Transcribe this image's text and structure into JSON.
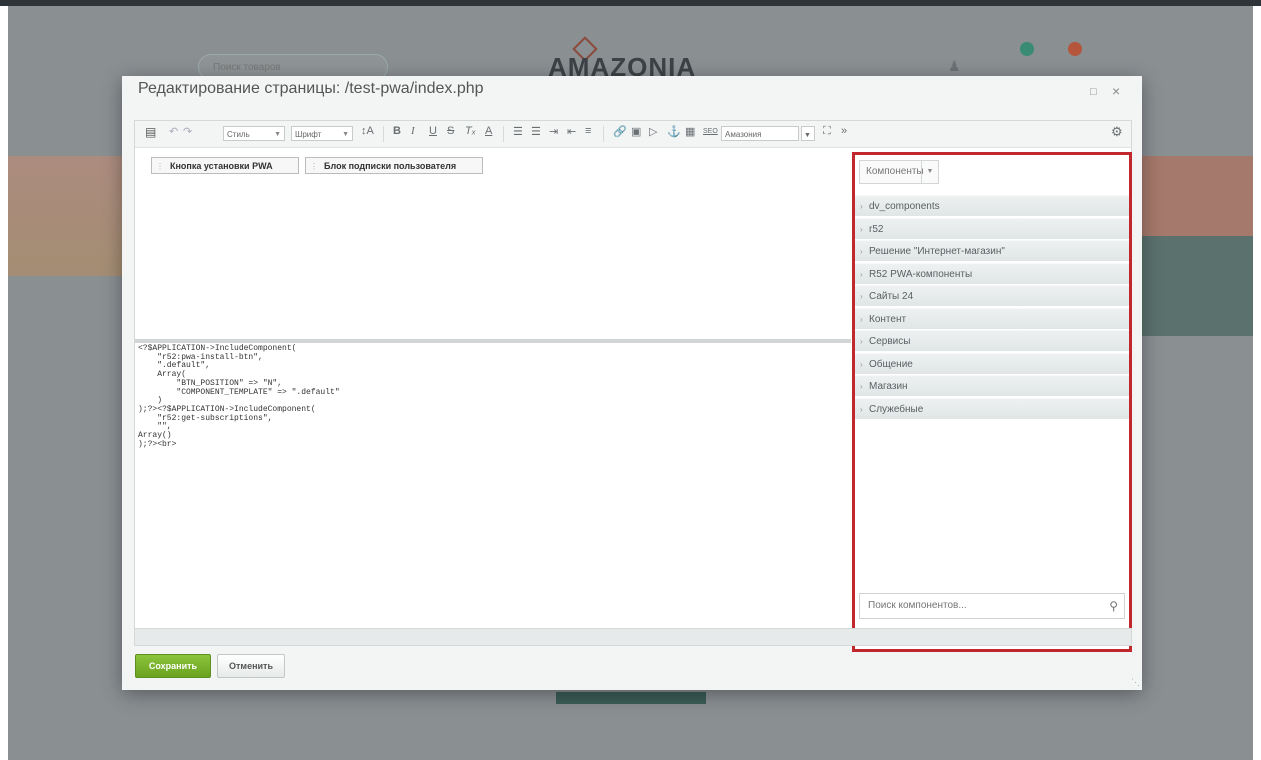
{
  "background_site": {
    "search_placeholder": "Поиск товаров",
    "logo": "AMAZONIA"
  },
  "dialog": {
    "title": "Редактирование страницы: /test-pwa/index.php",
    "maximize_icon": "□",
    "close_icon": "×"
  },
  "toolbar": {
    "style_label": "Стиль",
    "font_label": "Шрифт",
    "template_label": "Амазония",
    "seo_label": "SEO",
    "icons": [
      "code-view-icon",
      "undo-icon",
      "redo-icon",
      "font-size-icon",
      "bold-icon",
      "italic-icon",
      "underline-icon",
      "strikethrough-icon",
      "remove-format-icon",
      "font-color-icon",
      "ordered-list-icon",
      "unordered-list-icon",
      "indent-icon",
      "outdent-icon",
      "align-icon",
      "link-icon",
      "image-icon",
      "video-icon",
      "anchor-icon",
      "table-icon",
      "seo-icon",
      "fullscreen-icon",
      "more-icon",
      "settings-icon"
    ]
  },
  "visual_editor": {
    "chips": [
      "Кнопка установки PWA",
      "Блок подписки пользователя"
    ]
  },
  "code": {
    "lines": [
      "<?$APPLICATION->IncludeComponent(",
      "    \"r52:pwa-install-btn\",",
      "    \".default\",",
      "    Array(",
      "        \"BTN_POSITION\" => \"N\",",
      "        \"COMPONENT_TEMPLATE\" => \".default\"",
      "    )",
      ");?><?$APPLICATION->IncludeComponent(",
      "    \"r52:get-subscriptions\",",
      "    \"\",",
      "Array()",
      ");?><br>"
    ]
  },
  "components_panel": {
    "header_label": "Компоненты",
    "items": [
      "dv_components",
      "r52",
      "Решение \"Интернет-магазин\"",
      "R52 PWA-компоненты",
      "Сайты 24",
      "Контент",
      "Сервисы",
      "Общение",
      "Магазин",
      "Служебные"
    ],
    "search_placeholder": "Поиск компонентов..."
  },
  "footer": {
    "save_label": "Сохранить",
    "cancel_label": "Отменить"
  },
  "colors": {
    "highlight_border": "#c0282d",
    "save_button": "#7ab32e"
  }
}
